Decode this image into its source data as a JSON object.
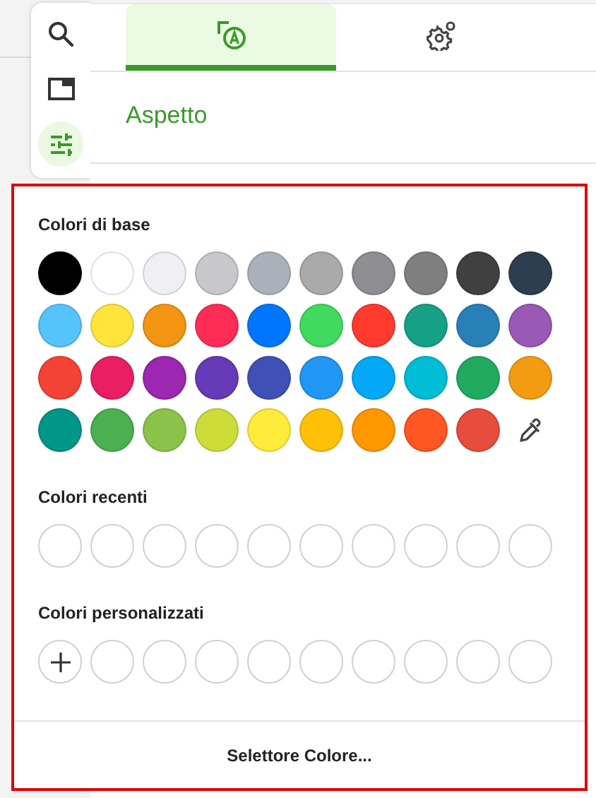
{
  "sidebar": {
    "items": [
      {
        "kind": "search",
        "selected": false
      },
      {
        "kind": "window",
        "selected": false
      },
      {
        "kind": "sliders",
        "selected": true
      }
    ]
  },
  "tabs": [
    {
      "kind": "appearance",
      "selected": true
    },
    {
      "kind": "settings",
      "selected": false
    }
  ],
  "section_title": "Aspetto",
  "color_popup": {
    "groups": [
      {
        "title": "Colori di base",
        "swatches": [
          {
            "kind": "swatch",
            "color": "#000000"
          },
          {
            "kind": "swatch",
            "color": "#ffffff"
          },
          {
            "kind": "swatch",
            "color": "#efeff4"
          },
          {
            "kind": "swatch",
            "color": "#c8c7cc"
          },
          {
            "kind": "swatch",
            "color": "#a9b2bb"
          },
          {
            "kind": "swatch",
            "color": "#aaaaaa"
          },
          {
            "kind": "swatch",
            "color": "#8e8e93"
          },
          {
            "kind": "swatch",
            "color": "#7f7f7f"
          },
          {
            "kind": "swatch",
            "color": "#404040"
          },
          {
            "kind": "swatch",
            "color": "#2c3e50"
          },
          {
            "kind": "swatch",
            "color": "#55c4fb"
          },
          {
            "kind": "swatch",
            "color": "#ffe53b"
          },
          {
            "kind": "swatch",
            "color": "#f39412"
          },
          {
            "kind": "swatch",
            "color": "#ff2d55"
          },
          {
            "kind": "swatch",
            "color": "#0076ff"
          },
          {
            "kind": "swatch",
            "color": "#41d95f"
          },
          {
            "kind": "swatch",
            "color": "#ff3b30"
          },
          {
            "kind": "swatch",
            "color": "#16a085"
          },
          {
            "kind": "swatch",
            "color": "#2980b9"
          },
          {
            "kind": "swatch",
            "color": "#9b59b6"
          },
          {
            "kind": "swatch",
            "color": "#f44336"
          },
          {
            "kind": "swatch",
            "color": "#e91e63"
          },
          {
            "kind": "swatch",
            "color": "#9c27b0"
          },
          {
            "kind": "swatch",
            "color": "#673ab7"
          },
          {
            "kind": "swatch",
            "color": "#3f51b5"
          },
          {
            "kind": "swatch",
            "color": "#2196f3"
          },
          {
            "kind": "swatch",
            "color": "#03a9f4"
          },
          {
            "kind": "swatch",
            "color": "#00bcd4"
          },
          {
            "kind": "swatch",
            "color": "#22ab60"
          },
          {
            "kind": "swatch",
            "color": "#f39c12"
          },
          {
            "kind": "swatch",
            "color": "#009688"
          },
          {
            "kind": "swatch",
            "color": "#4caf50"
          },
          {
            "kind": "swatch",
            "color": "#8bc34a"
          },
          {
            "kind": "swatch",
            "color": "#cddc39"
          },
          {
            "kind": "swatch",
            "color": "#ffeb3b"
          },
          {
            "kind": "swatch",
            "color": "#ffc107"
          },
          {
            "kind": "swatch",
            "color": "#ff9800"
          },
          {
            "kind": "swatch",
            "color": "#ff5722"
          },
          {
            "kind": "swatch",
            "color": "#e74c3c"
          },
          {
            "kind": "eyedropper"
          }
        ]
      },
      {
        "title": "Colori recenti",
        "swatches": [
          {
            "kind": "empty"
          },
          {
            "kind": "empty"
          },
          {
            "kind": "empty"
          },
          {
            "kind": "empty"
          },
          {
            "kind": "empty"
          },
          {
            "kind": "empty"
          },
          {
            "kind": "empty"
          },
          {
            "kind": "empty"
          },
          {
            "kind": "empty"
          },
          {
            "kind": "empty"
          }
        ]
      },
      {
        "title": "Colori personalizzati",
        "swatches": [
          {
            "kind": "add"
          },
          {
            "kind": "empty"
          },
          {
            "kind": "empty"
          },
          {
            "kind": "empty"
          },
          {
            "kind": "empty"
          },
          {
            "kind": "empty"
          },
          {
            "kind": "empty"
          },
          {
            "kind": "empty"
          },
          {
            "kind": "empty"
          },
          {
            "kind": "empty"
          }
        ]
      }
    ],
    "picker_button": "Selettore Colore..."
  }
}
